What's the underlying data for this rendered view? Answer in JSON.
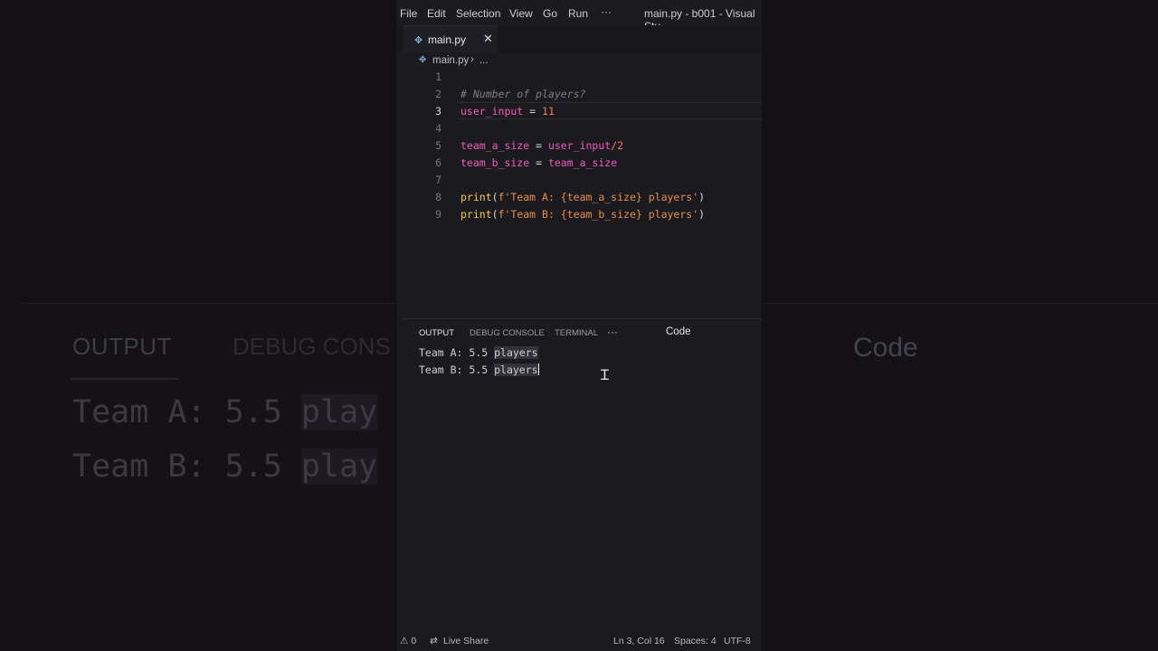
{
  "menu": {
    "items": [
      "File",
      "Edit",
      "Selection",
      "View",
      "Go",
      "Run"
    ],
    "more": "···",
    "window_title": "main.py - b001 - Visual Stu..."
  },
  "tab": {
    "icon": "python-icon",
    "filename": "main.py",
    "close": "✕"
  },
  "breadcrumb": {
    "file": "main.py",
    "separator": "›",
    "rest": "..."
  },
  "editor": {
    "active_line": 3,
    "lines": [
      {
        "n": "1"
      },
      {
        "n": "2"
      },
      {
        "n": "3"
      },
      {
        "n": "4"
      },
      {
        "n": "5"
      },
      {
        "n": "6"
      },
      {
        "n": "7"
      },
      {
        "n": "8"
      },
      {
        "n": "9"
      }
    ],
    "code": {
      "l2": "# Number of players?",
      "l3_var": "user_input",
      "l3_op": " = ",
      "l3_num": "11",
      "l5_var": "team_a_size",
      "l5_op": " = ",
      "l5_var2": "user_input",
      "l5_div": "/",
      "l5_num": "2",
      "l6_var": "team_b_size",
      "l6_op": " = ",
      "l6_var2": "team_a_size",
      "l8_fn": "print",
      "l8_open": "(",
      "l8_str": "f'Team A: {team_a_size} players'",
      "l8_close": ")",
      "l9_fn": "print",
      "l9_open": "(",
      "l9_str": "f'Team B: {team_b_size} players'",
      "l9_close": ")"
    }
  },
  "panel": {
    "tabs": [
      "OUTPUT",
      "DEBUG CONSOLE",
      "TERMINAL"
    ],
    "more": "···",
    "channel": "Code",
    "output": [
      {
        "prefix": "Team A: 5.5 ",
        "selected": "players"
      },
      {
        "prefix": "Team B: 5.5 ",
        "selected": "players"
      }
    ]
  },
  "status": {
    "problems": "⚠ 0",
    "live_share": "Live Share",
    "position": "Ln 3, Col 16",
    "spaces": "Spaces: 4",
    "encoding": "UTF-8"
  },
  "background": {
    "output_tab": "OUTPUT",
    "debug_tab": "DEBUG CONS",
    "line1_prefix": "Team A: 5.5 ",
    "line1_hl": "play",
    "line2_prefix": "Team B: 5.5 ",
    "line2_hl": "play",
    "code_label": "Code"
  },
  "colors": {
    "variable": "#f05bc0",
    "number": "#f57a5a",
    "function": "#f2c84b",
    "string": "#e68f4f",
    "comment": "#7f7d87"
  }
}
